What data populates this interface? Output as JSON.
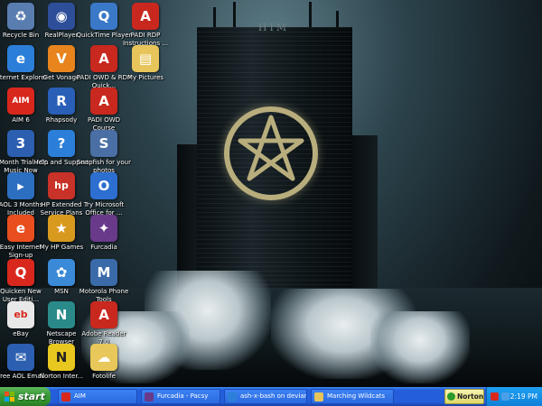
{
  "desktop": {
    "wallpaper_logo_text": "HIM",
    "icons": [
      {
        "name": "icon-recycle-bin",
        "label": "Recycle Bin",
        "glyph": "♻",
        "color": "#5a7db0"
      },
      {
        "name": "icon-realplayer",
        "label": "RealPlayer",
        "glyph": "◉",
        "color": "#2d4f9a"
      },
      {
        "name": "icon-quicktime",
        "label": "QuickTime Player",
        "glyph": "Q",
        "color": "#3a78c8"
      },
      {
        "name": "icon-padi-rdp-instructions",
        "label": "PADI RDP Instructions ...",
        "glyph": "A",
        "color": "#c8281e"
      },
      {
        "name": "icon-internet-explorer",
        "label": "Internet Explorer",
        "glyph": "e",
        "color": "#2c7fd8"
      },
      {
        "name": "icon-get-vonage",
        "label": "Get Vonage",
        "glyph": "V",
        "color": "#e8841e"
      },
      {
        "name": "icon-padi-owd-rdp-quick",
        "label": "PADI OWD & RDP Quick...",
        "glyph": "A",
        "color": "#c8281e"
      },
      {
        "name": "icon-my-pictures",
        "label": "My Pictures",
        "glyph": "▤",
        "color": "#e7c55a"
      },
      {
        "name": "icon-aim6",
        "label": "AIM 6",
        "glyph": "AIM",
        "color": "#d8281e"
      },
      {
        "name": "icon-rhapsody",
        "label": "Rhapsody",
        "glyph": "R",
        "color": "#2a5fb8"
      },
      {
        "name": "icon-padi-owd-course",
        "label": "PADI OWD Course",
        "glyph": "A",
        "color": "#c8281e"
      },
      {
        "name": "icon-3month-trial-aol-music",
        "label": "3 Month Trial AOL Music Now",
        "glyph": "3",
        "color": "#2c5fb0"
      },
      {
        "name": "icon-help-and-support",
        "label": "Help and Support",
        "glyph": "?",
        "color": "#2c7fd8"
      },
      {
        "name": "icon-snapfish",
        "label": "Snapfish for your photos",
        "glyph": "S",
        "color": "#4a6fa5"
      },
      {
        "name": "icon-aol-3-months-included",
        "label": "AOL 3 Months Included",
        "glyph": "▸",
        "color": "#2c6fc0"
      },
      {
        "name": "icon-hp-extended-service-plans",
        "label": "HP Extended Service Plans",
        "glyph": "hp",
        "color": "#c83228"
      },
      {
        "name": "icon-try-microsoft-office",
        "label": "Try Microsoft Office for ...",
        "glyph": "O",
        "color": "#2c6fd0"
      },
      {
        "name": "icon-easy-internet-signup",
        "label": "Easy Internet Sign-up",
        "glyph": "e",
        "color": "#e84e1e"
      },
      {
        "name": "icon-my-hp-games",
        "label": "My HP Games",
        "glyph": "★",
        "color": "#d89a1e"
      },
      {
        "name": "icon-furcadia",
        "label": "Furcadia",
        "glyph": "✦",
        "color": "#6a3a8a"
      },
      {
        "name": "icon-quicken-new-user",
        "label": "Quicken New User Editi...",
        "glyph": "Q",
        "color": "#d8281e"
      },
      {
        "name": "icon-msn",
        "label": "MSN",
        "glyph": "✿",
        "color": "#3a8ad8"
      },
      {
        "name": "icon-motorola-phone-tools",
        "label": "Motorola Phone Tools",
        "glyph": "M",
        "color": "#3a6aa8"
      },
      {
        "name": "icon-ebay",
        "label": "eBay",
        "glyph": "eb",
        "color": "#e8e8e8"
      },
      {
        "name": "icon-netscape-browser",
        "label": "Netscape Browser",
        "glyph": "N",
        "color": "#2a8a8a"
      },
      {
        "name": "icon-adobe-reader",
        "label": "Adobe Reader 7.0",
        "glyph": "A",
        "color": "#c8281e"
      },
      {
        "name": "icon-free-aol-email",
        "label": "Free AOL Email",
        "glyph": "✉",
        "color": "#2c5fb0"
      },
      {
        "name": "icon-norton-internet",
        "label": "Norton Inter...",
        "glyph": "N",
        "color": "#e8c81e"
      },
      {
        "name": "icon-fotolife",
        "label": "Fotolife",
        "glyph": "☁",
        "color": "#e8c85a"
      }
    ]
  },
  "taskbar": {
    "start_label": "start",
    "tasks": [
      {
        "name": "task-aim",
        "label": "AIM",
        "color": "#d8281e"
      },
      {
        "name": "task-furcadia",
        "label": "Furcadia - Pacsy",
        "color": "#6a3a8a"
      },
      {
        "name": "task-deviantart",
        "label": "ash-x-bash on devian...",
        "color": "#2c7fd8"
      },
      {
        "name": "task-marching-wildcats",
        "label": "Marching Wildcats",
        "color": "#e7c55a"
      }
    ],
    "norton_label": "Norton",
    "clock": "2:19 PM"
  }
}
